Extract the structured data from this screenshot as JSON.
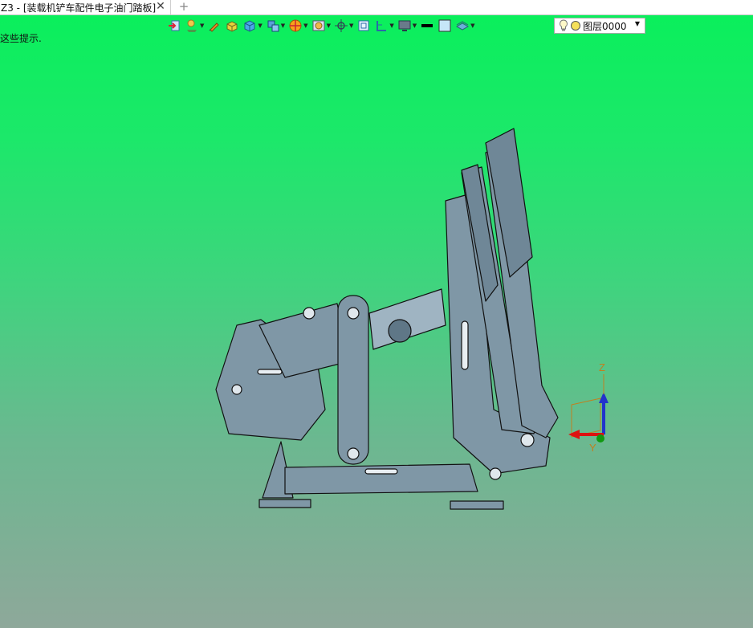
{
  "tab": {
    "title": "Z3 - [装载机铲车配件电子油门踏板]",
    "close": "✕",
    "add": "+"
  },
  "hint": "这些提示.",
  "layer": {
    "name": "图层0000"
  },
  "triad": {
    "z": "Z",
    "y": "Y"
  },
  "toolbar_icons": [
    "import-icon",
    "layer-manager-icon",
    "pen-icon",
    "solid-icon",
    "cube-icon",
    "assembly-icon",
    "color-icon",
    "render-icon",
    "snap-icon",
    "frame-icon",
    "view-icon",
    "display-icon",
    "line-color-icon",
    "fill-color-icon",
    "material-icon",
    "bulb-icon"
  ],
  "colors": {
    "accent": "#08f05a",
    "model": "#7b94a4",
    "bg_bottom": "#8ea89a"
  }
}
